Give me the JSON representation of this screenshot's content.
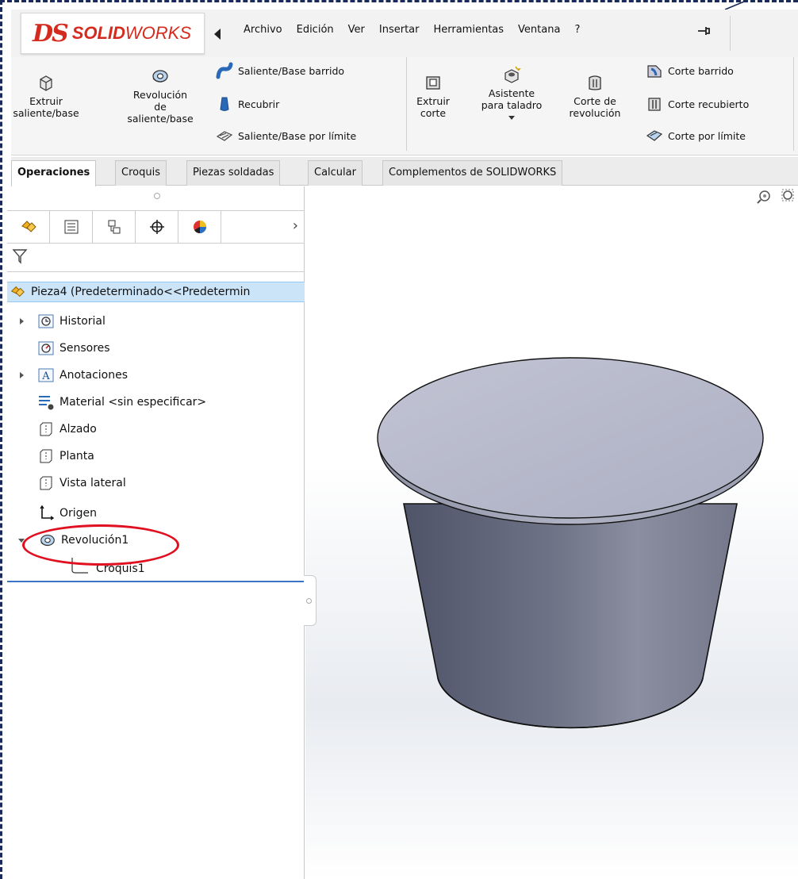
{
  "brand": {
    "logo_mark": "DS",
    "logo_solid": "SOLID",
    "logo_works": "WORKS",
    "accent_color": "#d52b1e"
  },
  "menu": {
    "items": [
      "Archivo",
      "Edición",
      "Ver",
      "Insertar",
      "Herramientas",
      "Ventana",
      "?"
    ]
  },
  "ribbon": {
    "extruir_saliente": "Extruir\nsaliente/base",
    "revolucion_saliente": "Revolución\nde\nsaliente/base",
    "saliente_barrido": "Saliente/Base barrido",
    "recubrir": "Recubrir",
    "saliente_limite": "Saliente/Base por límite",
    "extruir_corte": "Extruir\ncorte",
    "asistente_taladro": "Asistente\npara taladro",
    "corte_revolucion": "Corte de\nrevolución",
    "corte_barrido": "Corte barrido",
    "corte_recubierto": "Corte recubierto",
    "corte_limite": "Corte por límite"
  },
  "tabs": [
    "Operaciones",
    "Croquis",
    "Piezas soldadas",
    "Calcular",
    "Complementos de SOLIDWORKS"
  ],
  "tree": {
    "root": "Pieza4  (Predeterminado<<Predetermin",
    "items": {
      "historial": "Historial",
      "sensores": "Sensores",
      "anotaciones": "Anotaciones",
      "material": "Material <sin especificar>",
      "alzado": "Alzado",
      "planta": "Planta",
      "vista_lateral": "Vista lateral",
      "origen": "Origen",
      "revolucion1": "Revolución1",
      "croquis1": "Croquis1"
    }
  },
  "icons": {
    "pin": "pin-icon",
    "filter": "filter-icon",
    "zoom": "zoom-to-fit-icon"
  },
  "colors": {
    "highlight_oval": "#e01020",
    "selection_row": "#cce4f7",
    "model_gray": "#6a6f80",
    "model_top": "#b9bccd"
  }
}
